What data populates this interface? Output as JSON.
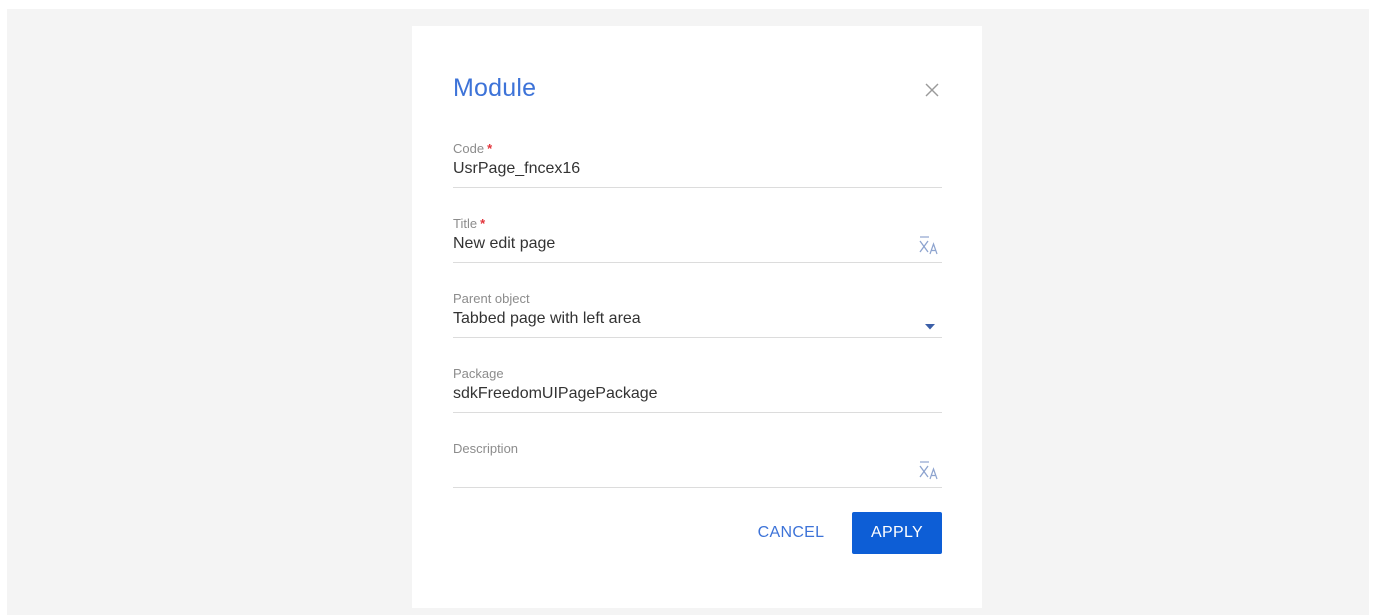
{
  "dialog": {
    "title": "Module",
    "close_icon": "close-icon",
    "accent_color": "#3d73d8",
    "required_marker": "*",
    "fields": {
      "code": {
        "label": "Code",
        "required": true,
        "value": "UsrPage_fncex16"
      },
      "title": {
        "label": "Title",
        "required": true,
        "value": "New edit page",
        "icon": "translate-icon"
      },
      "parent_object": {
        "label": "Parent object",
        "required": false,
        "value": "Tabbed page with left area",
        "icon": "chevron-down-icon"
      },
      "package": {
        "label": "Package",
        "required": false,
        "value": "sdkFreedomUIPagePackage"
      },
      "description": {
        "label": "Description",
        "required": false,
        "value": "",
        "icon": "translate-icon"
      }
    },
    "buttons": {
      "cancel_label": "CANCEL",
      "apply_label": "APPLY",
      "apply_color": "#0d5ed6"
    }
  }
}
